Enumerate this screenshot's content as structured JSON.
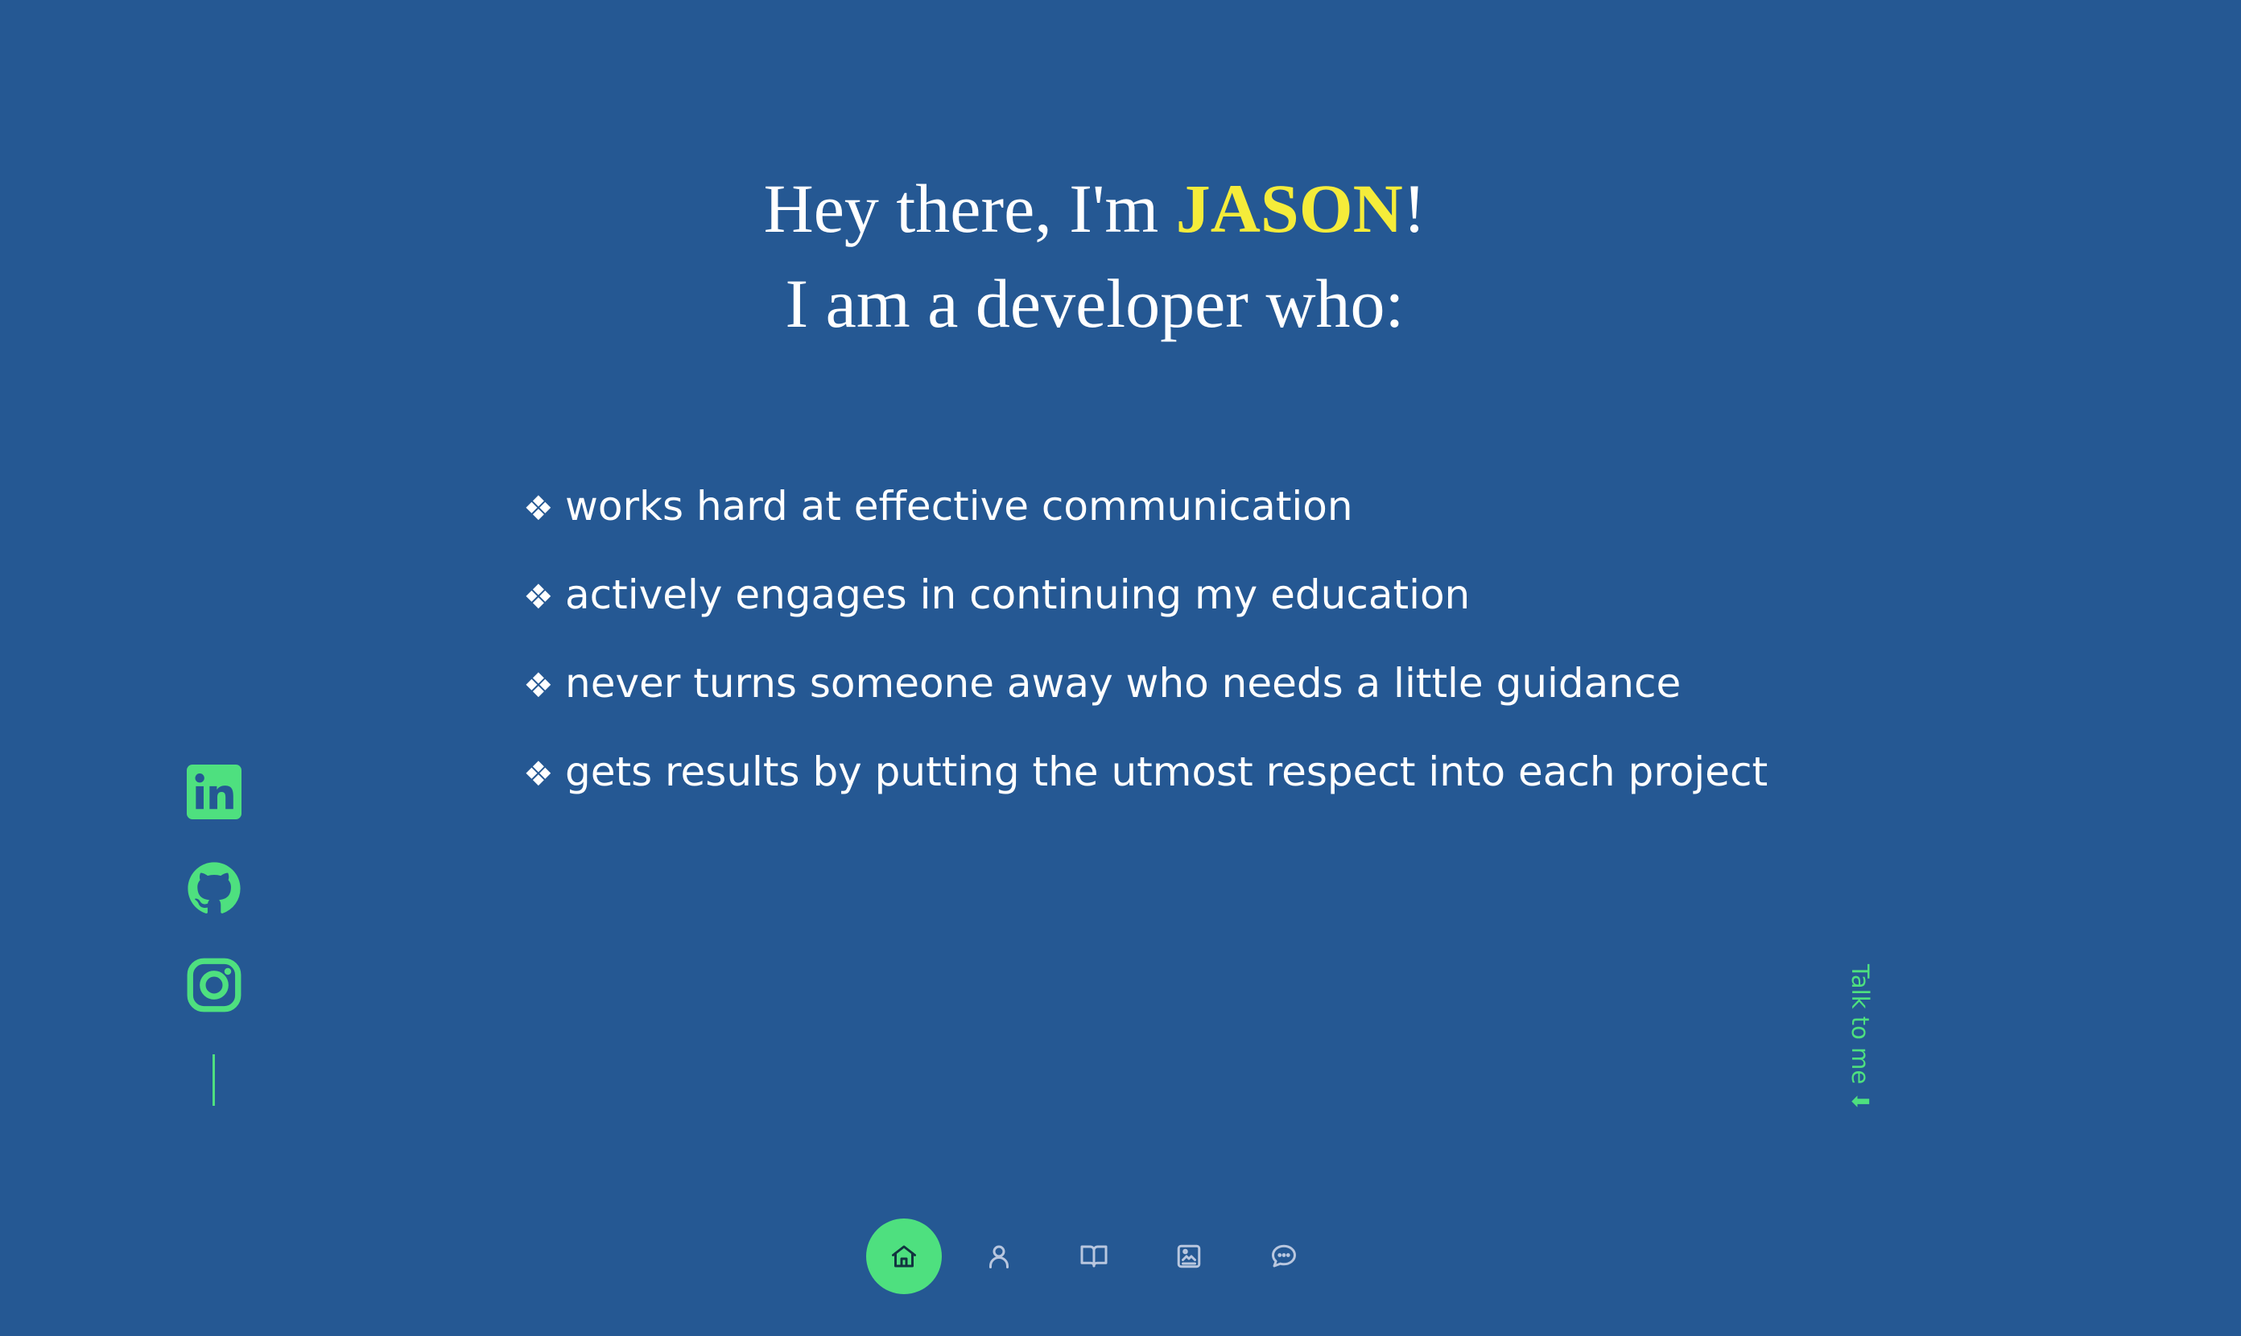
{
  "hero": {
    "greeting_prefix": "Hey there, I'm ",
    "name": "JASON",
    "greeting_suffix": "!",
    "subtitle": "I am a developer who:"
  },
  "traits": [
    {
      "bullet": "❖",
      "text": "works hard at effective communication"
    },
    {
      "bullet": "❖",
      "text": "actively engages in continuing my education"
    },
    {
      "bullet": "❖",
      "text": "never turns someone away who needs a little guidance"
    },
    {
      "bullet": "❖",
      "text": "gets results by putting the utmost respect into each project"
    }
  ],
  "socials": {
    "icons": [
      "linkedin-icon",
      "github-icon",
      "instagram-icon"
    ]
  },
  "talk_link": {
    "label": "Talk to me ⬇"
  },
  "nav": {
    "items": [
      {
        "icon": "home-icon",
        "active": true
      },
      {
        "icon": "user-icon",
        "active": false
      },
      {
        "icon": "book-icon",
        "active": false
      },
      {
        "icon": "portfolio-icon",
        "active": false
      },
      {
        "icon": "chat-icon",
        "active": false
      }
    ]
  },
  "colors": {
    "background": "#255893",
    "accent_green": "#4ee07f",
    "highlight_yellow": "#f5ec3a",
    "text": "#ffffff",
    "nav_icon": "#b9c7df"
  }
}
